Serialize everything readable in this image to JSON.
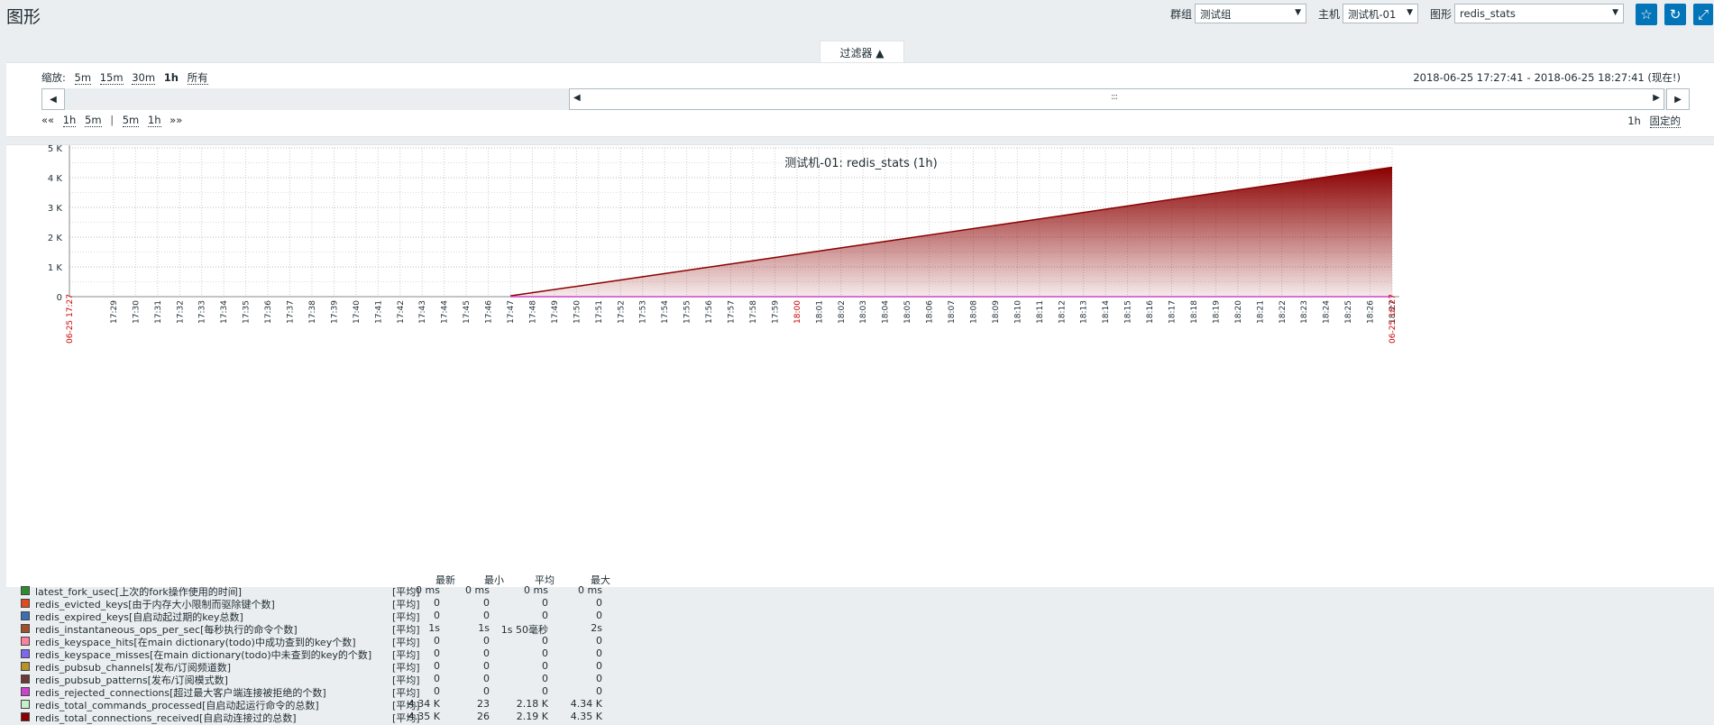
{
  "header": {
    "title": "图形",
    "group_label": "群组",
    "group_value": "测试组",
    "host_label": "主机",
    "host_value": "测试机-01",
    "graph_label": "图形",
    "graph_value": "redis_stats"
  },
  "filter": {
    "tab_label": "过滤器 ▲",
    "zoom_label": "缩放:",
    "zoom_options": [
      "5m",
      "15m",
      "30m",
      "1h",
      "所有"
    ],
    "zoom_selected": "1h",
    "range_from": "2018-06-25 17:27:41",
    "range_sep": "-",
    "range_to": "2018-06-25 18:27:41 (现在!)",
    "nav_back": [
      "««",
      "1h",
      "5m"
    ],
    "nav_sep": "|",
    "nav_fwd": [
      "5m",
      "1h",
      "»»"
    ],
    "period": "1h",
    "fixed_label": "固定的",
    "grip": ":::"
  },
  "chart_data": {
    "type": "area",
    "title": "测试机-01: redis_stats (1h)",
    "ylim": [
      0,
      5000
    ],
    "y_ticks": [
      "0",
      "1 K",
      "2 K",
      "3 K",
      "4 K",
      "5 K"
    ],
    "x_start_label": "06-25 17:27",
    "x_end_label": "06-25 18:27",
    "x_ticks": [
      "17:29",
      "17:30",
      "17:31",
      "17:32",
      "17:33",
      "17:34",
      "17:35",
      "17:36",
      "17:37",
      "17:38",
      "17:39",
      "17:40",
      "17:41",
      "17:42",
      "17:43",
      "17:44",
      "17:45",
      "17:46",
      "17:47",
      "17:48",
      "17:49",
      "17:50",
      "17:51",
      "17:52",
      "17:53",
      "17:54",
      "17:55",
      "17:56",
      "17:57",
      "17:58",
      "17:59",
      "18:00",
      "18:01",
      "18:02",
      "18:03",
      "18:04",
      "18:05",
      "18:06",
      "18:07",
      "18:08",
      "18:09",
      "18:10",
      "18:11",
      "18:12",
      "18:13",
      "18:14",
      "18:15",
      "18:16",
      "18:17",
      "18:18",
      "18:19",
      "18:20",
      "18:21",
      "18:22",
      "18:23",
      "18:24",
      "18:25",
      "18:26",
      "18:27"
    ],
    "highlight_tick": "18:00",
    "series": [
      {
        "name": "redis_total_connections_received",
        "color": "#8b0000",
        "x": [
          "17:47",
          "17:52",
          "17:57",
          "18:02",
          "18:07",
          "18:12",
          "18:17",
          "18:22",
          "18:27"
        ],
        "values": [
          26,
          560,
          1100,
          1640,
          2180,
          2720,
          3270,
          3800,
          4350
        ]
      },
      {
        "name": "redis_rejected_connections",
        "color": "#cc44cc",
        "x": [
          "17:47",
          "18:27"
        ],
        "values": [
          0,
          0
        ]
      }
    ],
    "grid": true
  },
  "legend": {
    "columns": [
      "最新",
      "最小",
      "平均",
      "最大"
    ],
    "items": [
      {
        "color": "#2e8b2e",
        "name": "latest_fork_usec[上次的fork操作使用的时间]",
        "func": "[平均]",
        "last": "0 ms",
        "min": "0 ms",
        "avg": "0 ms",
        "max": "0 ms"
      },
      {
        "color": "#e04b1e",
        "name": "redis_evicted_keys[由于内存大小限制而驱除键个数]",
        "func": "[平均]",
        "last": "0",
        "min": "0",
        "avg": "0",
        "max": "0"
      },
      {
        "color": "#3a6fb0",
        "name": "redis_expired_keys[自启动起过期的key总数]",
        "func": "[平均]",
        "last": "0",
        "min": "0",
        "avg": "0",
        "max": "0"
      },
      {
        "color": "#a0522d",
        "name": "redis_instantaneous_ops_per_sec[每秒执行的命令个数]",
        "func": "[平均]",
        "last": "1s",
        "min": "1s",
        "avg": "1s 50毫秒",
        "max": "2s"
      },
      {
        "color": "#ff7fa0",
        "name": "redis_keyspace_hits[在main dictionary(todo)中成功查到的key个数]",
        "func": "[平均]",
        "last": "0",
        "min": "0",
        "avg": "0",
        "max": "0"
      },
      {
        "color": "#7b68ee",
        "name": "redis_keyspace_misses[在main dictionary(todo)中未查到的key的个数]",
        "func": "[平均]",
        "last": "0",
        "min": "0",
        "avg": "0",
        "max": "0"
      },
      {
        "color": "#b8932a",
        "name": "redis_pubsub_channels[发布/订阅频道数]",
        "func": "[平均]",
        "last": "0",
        "min": "0",
        "avg": "0",
        "max": "0"
      },
      {
        "color": "#6b3a3a",
        "name": "redis_pubsub_patterns[发布/订阅模式数]",
        "func": "[平均]",
        "last": "0",
        "min": "0",
        "avg": "0",
        "max": "0"
      },
      {
        "color": "#cc44cc",
        "name": "redis_rejected_connections[超过最大客户端连接被拒绝的个数]",
        "func": "[平均]",
        "last": "0",
        "min": "0",
        "avg": "0",
        "max": "0"
      },
      {
        "color": "#c8f0c8",
        "name": "redis_total_commands_processed[自启动起运行命令的总数]",
        "func": "[平均]",
        "last": "4.34 K",
        "min": "23",
        "avg": "2.18 K",
        "max": "4.34 K"
      },
      {
        "color": "#8b0000",
        "name": "redis_total_connections_received[自启动连接过的总数]",
        "func": "[平均]",
        "last": "4.35 K",
        "min": "26",
        "avg": "2.19 K",
        "max": "4.35 K"
      }
    ]
  }
}
